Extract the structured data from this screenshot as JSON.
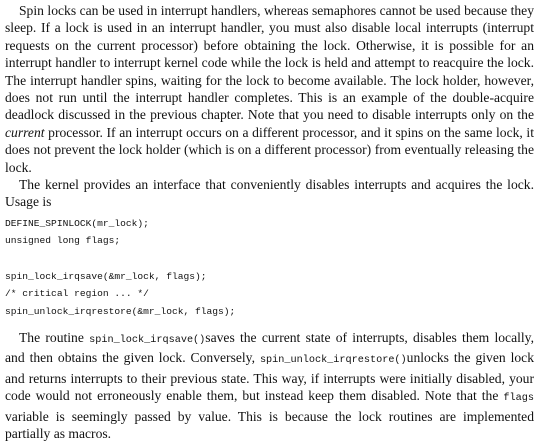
{
  "para1": {
    "s1": "Spin locks can be used in interrupt handlers, whereas semaphores cannot be used because they sleep. If a lock is used in an interrupt handler, you must also disable local interrupts (interrupt requests on the current processor) before obtaining the lock. Otherwise, it is possible for an interrupt handler to interrupt kernel code while the lock is held and attempt to reacquire the lock. The interrupt handler spins, waiting for the lock to become available. The lock holder, however, does not run until the interrupt handler completes. This is an example of the double-acquire deadlock discussed in the previous chapter. Note that you need to disable interrupts only on the ",
    "em": "current",
    "s2": " processor. If an interrupt occurs on a different processor, and it spins on the same lock, it does not prevent the lock holder (which is on a different processor) from eventually releasing the lock."
  },
  "para2": "The kernel provides an interface that conveniently disables interrupts and acquires the lock. Usage is",
  "code": {
    "line1": "DEFINE_SPINLOCK(mr_lock);",
    "line2": "unsigned long flags;",
    "line3": "spin_lock_irqsave(&mr_lock, flags);",
    "line4": "/* critical region ... */",
    "line5": "spin_unlock_irqrestore(&mr_lock, flags);"
  },
  "para3": {
    "t1": "The routine ",
    "c1": "spin_lock_irqsave()",
    "t2": "saves the current state of interrupts, disables them locally, and then obtains the given lock. Conversely, ",
    "c2": "spin_unlock_irqrestore()",
    "t3": "unlocks the given lock and returns interrupts to their previous state. This way, if interrupts were initially disabled, your code would not erroneously enable them, but instead keep them disabled. Note that the ",
    "c3": "flags",
    "t4": " variable is seemingly passed by value. This is because the lock routines are implemented partially as macros."
  }
}
